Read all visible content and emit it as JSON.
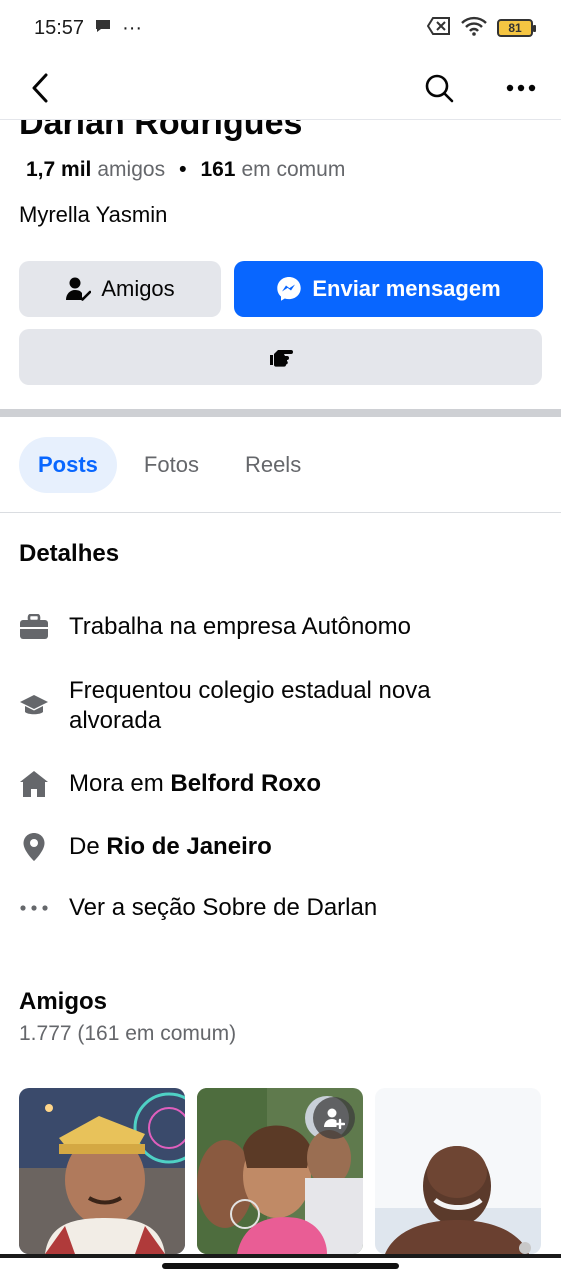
{
  "status_bar": {
    "time": "15:57",
    "more": "···",
    "battery": "81"
  },
  "profile": {
    "name": "Darlan Rodrigues",
    "friends_count": "1,7 mil",
    "friends_label": "amigos",
    "separator": "•",
    "mutual_count": "161",
    "mutual_label": "em comum",
    "mutual_friend": "Myrella Yasmin"
  },
  "actions": {
    "friends_label": "Amigos",
    "message_label": "Enviar mensagem",
    "message_color": "#0866ff"
  },
  "tabs": [
    {
      "label": "Posts",
      "active": true
    },
    {
      "label": "Fotos",
      "active": false
    },
    {
      "label": "Reels",
      "active": false
    }
  ],
  "details": {
    "title": "Detalhes",
    "work": {
      "prefix": "Trabalha na empresa Autônomo",
      "icon": "briefcase-icon"
    },
    "school": {
      "line1": "Frequentou colegio estadual nova",
      "line2": "alvorada",
      "icon": "graduation-cap-icon"
    },
    "lives": {
      "prefix": "Mora em ",
      "place": "Belford Roxo",
      "icon": "home-icon"
    },
    "from": {
      "prefix": "De ",
      "place": "Rio de Janeiro",
      "icon": "location-pin-icon"
    },
    "about": {
      "text": "Ver a seção Sobre de Darlan",
      "icon": "more-dots-icon"
    }
  },
  "friends": {
    "title": "Amigos",
    "count": "1.777 (161 em comum)"
  }
}
